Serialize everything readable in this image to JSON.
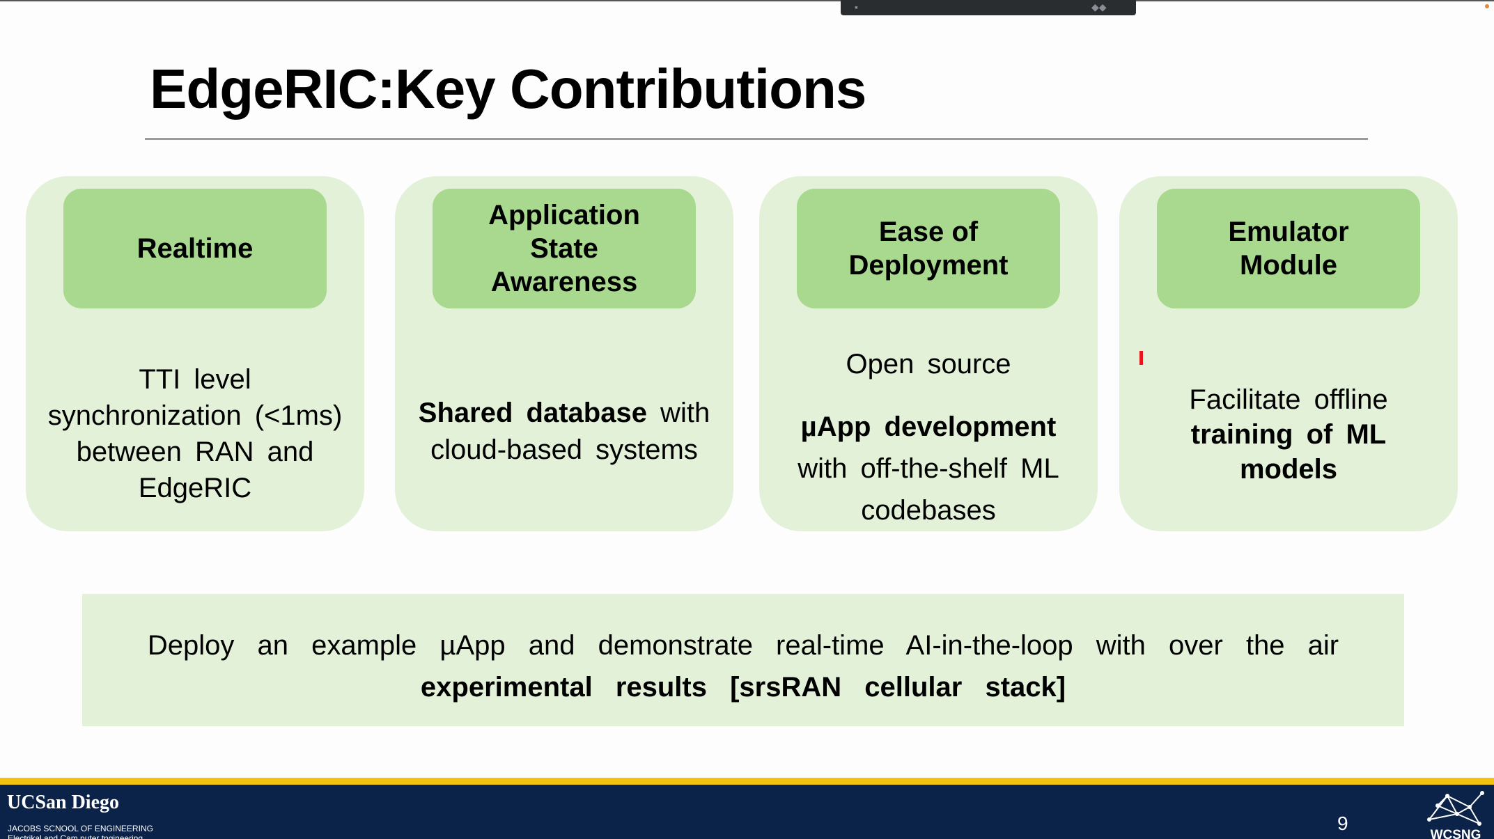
{
  "slide": {
    "title": "EdgeRIC:Key Contributions",
    "page_number": "9"
  },
  "cards": [
    {
      "header_lines": [
        "Realtime"
      ],
      "body_lines": [
        "TTI level",
        "synchronization (<1ms)",
        "between RAN and",
        "EdgeRIC"
      ]
    },
    {
      "header_lines": [
        "Application",
        "State",
        "Awareness"
      ],
      "body_bold": "Shared database",
      "body_rest": " with",
      "body_line2": "cloud-based systems"
    },
    {
      "header_lines": [
        "Ease of",
        "Deployment"
      ],
      "body_line1": "Open source",
      "body_bold": "µApp development",
      "body_line3": "with off-the-shelf ML",
      "body_line4": "codebases"
    },
    {
      "header_lines": [
        "Emulator",
        "Module"
      ],
      "body_line1": "Facilitate offline",
      "body_bold_1": "training of ML",
      "body_bold_2": "models"
    }
  ],
  "summary": {
    "line1": "Deploy an example µApp and demonstrate real-time AI-in-the-loop with over the air",
    "line2_bold": "experimental results [srsRAN cellular stack]"
  },
  "footer": {
    "university": "UCSan Diego",
    "school_line1": "JACOBS SCNOOL OF ENGINEERING",
    "school_line2": "Electrikal and Cam puter tngineering",
    "lab_logo_text": "WCSNG"
  },
  "colors": {
    "card_bg": "#e3f1d9",
    "card_header_bg": "#a8d98e",
    "footer_bg": "#0b2249",
    "footer_accent": "#f3c313",
    "cursor_mark": "#e8141e"
  }
}
